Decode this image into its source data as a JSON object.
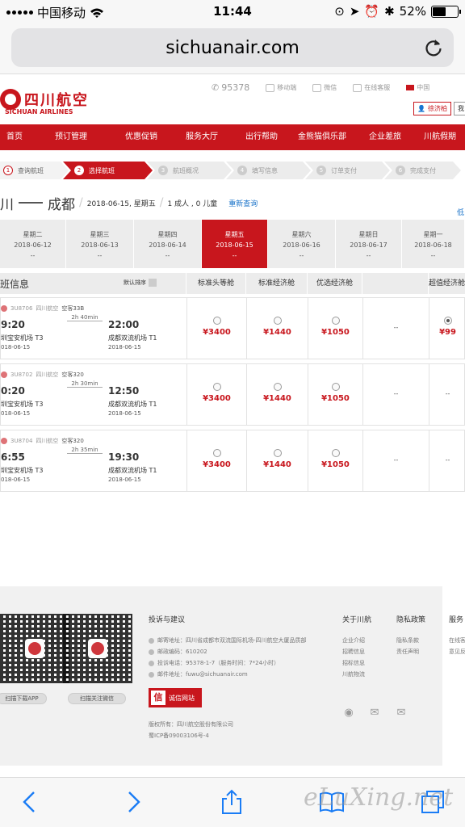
{
  "status_bar": {
    "carrier": "中国移动",
    "time": "11:44",
    "battery": "52%",
    "battery_level": 0.52
  },
  "browser": {
    "url": "sichuanair.com"
  },
  "header": {
    "logo_cn": "四川航空",
    "logo_en": "SICHUAN AIRLINES",
    "phone": "95378",
    "links": [
      "移动端",
      "微信",
      "在线客服"
    ],
    "language": "中国",
    "user_name": "徐济柏",
    "extra_btn": "我"
  },
  "nav": {
    "items": [
      "首页",
      "预订管理",
      "优惠促销",
      "服务大厅",
      "出行帮助",
      "金熊猫俱乐部",
      "企业差旅",
      "川航假期"
    ]
  },
  "steps": [
    {
      "num": "1",
      "label": "查询航班"
    },
    {
      "num": "2",
      "label": "选择航班"
    },
    {
      "num": "3",
      "label": "航班概况"
    },
    {
      "num": "4",
      "label": "填写信息"
    },
    {
      "num": "5",
      "label": "订单支付"
    },
    {
      "num": "6",
      "label": "完成支付"
    }
  ],
  "route": {
    "from": "川",
    "to": "成都",
    "date": "2018-06-15, 星期五",
    "pax": "1 成人 , 0 儿童",
    "research": "重新查询",
    "edge_link": "低"
  },
  "dates": [
    {
      "day": "星期二",
      "date": "2018-06-12",
      "price": "--"
    },
    {
      "day": "星期三",
      "date": "2018-06-13",
      "price": "--"
    },
    {
      "day": "星期四",
      "date": "2018-06-14",
      "price": "--"
    },
    {
      "day": "星期五",
      "date": "2018-06-15",
      "price": "--"
    },
    {
      "day": "星期六",
      "date": "2018-06-16",
      "price": "--"
    },
    {
      "day": "星期日",
      "date": "2018-06-17",
      "price": "--"
    },
    {
      "day": "星期一",
      "date": "2018-06-18",
      "price": "--"
    }
  ],
  "table": {
    "info_title": "班信息",
    "sort_label": "默认排序",
    "columns": [
      "标准头等舱",
      "标准经济舱",
      "优选经济舱",
      "",
      "超值经济舱"
    ]
  },
  "flights": [
    {
      "code": "3U8706",
      "airline": "四川航空",
      "plane": "空客33B",
      "duration": "2h 40min",
      "dep_time": "9:20",
      "arr_time": "22:00",
      "dep_airport": "圳宝安机场   T3",
      "arr_airport": "成都双流机场   T1",
      "dep_date": "018-06-15",
      "arr_date": "2018-06-15",
      "prices": [
        "¥3400",
        "¥1440",
        "¥1050",
        "--",
        "¥99"
      ],
      "selected_col": 4
    },
    {
      "code": "3U8702",
      "airline": "四川航空",
      "plane": "空客320",
      "duration": "2h 30min",
      "dep_time": "0:20",
      "arr_time": "12:50",
      "dep_airport": "圳宝安机场   T3",
      "arr_airport": "成都双流机场   T1",
      "dep_date": "018-06-15",
      "arr_date": "2018-06-15",
      "prices": [
        "¥3400",
        "¥1440",
        "¥1050",
        "--",
        "--"
      ],
      "selected_col": -1
    },
    {
      "code": "3U8704",
      "airline": "四川航空",
      "plane": "空客320",
      "duration": "2h 35min",
      "dep_time": "6:55",
      "arr_time": "19:30",
      "dep_airport": "圳宝安机场   T3",
      "arr_airport": "成都双流机场   T1",
      "dep_date": "018-06-15",
      "arr_date": "2018-06-15",
      "prices": [
        "¥3400",
        "¥1440",
        "¥1050",
        "--",
        "--"
      ],
      "selected_col": -1
    }
  ],
  "footer": {
    "qr1_label": "扫描下载APP",
    "qr2_label": "扫描关注微信",
    "complaint_title": "投诉与建议",
    "address": "邮寄地址：四川省成都市双流国际机场-四川航空大厦品质部",
    "postcode": "邮政编码：610202",
    "hotline": "投诉电话：95378-1-7（服务时间：7*24小时）",
    "email": "邮件地址：fuwu@sichuanair.com",
    "cred_badge": "信",
    "cred_label": "诚信网站",
    "copyright": "版权所有：四川航空股份有限公司",
    "icp": "蜀ICP备09003106号-4",
    "about_title": "关于川航",
    "about_links": [
      "企业介绍",
      "招聘信息",
      "招标信息",
      "川航物流"
    ],
    "privacy_title": "隐私政策",
    "privacy_links": [
      "隐私条款",
      "责任声明"
    ],
    "service_title": "服务",
    "service_links": [
      "在线客",
      "意见反"
    ]
  },
  "watermark": "eLuXing.net"
}
